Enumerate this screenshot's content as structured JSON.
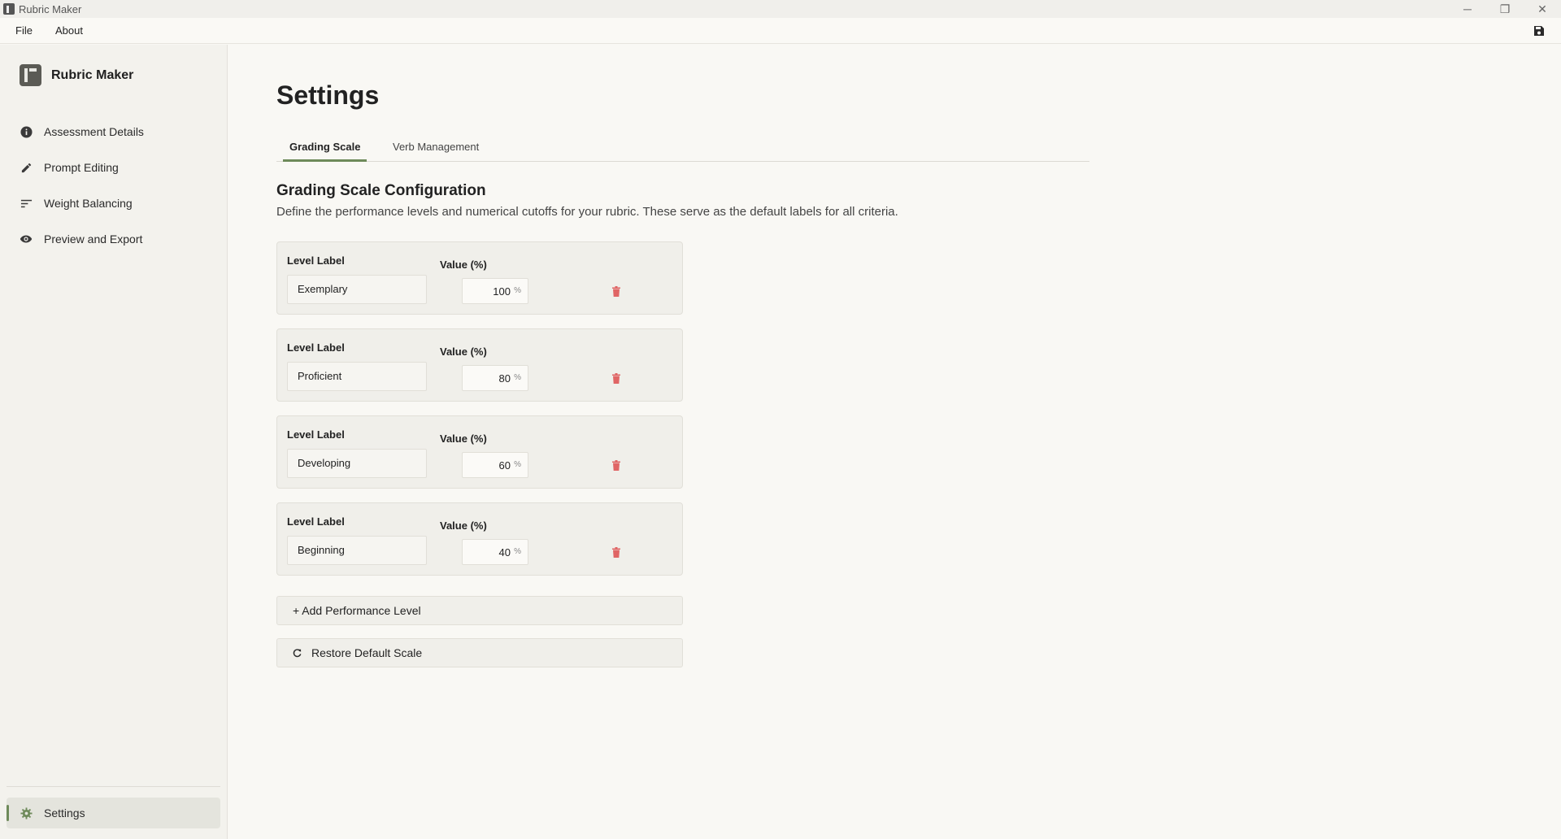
{
  "window": {
    "title": "Rubric Maker",
    "controls": {
      "minimize": "─",
      "maximize": "❐",
      "close": "✕"
    }
  },
  "menu": {
    "file": "File",
    "about": "About"
  },
  "sidebar": {
    "brand": "Rubric Maker",
    "items": [
      {
        "label": "Assessment Details",
        "icon": "info-icon"
      },
      {
        "label": "Prompt Editing",
        "icon": "pencil-icon"
      },
      {
        "label": "Weight Balancing",
        "icon": "sort-lines-icon"
      },
      {
        "label": "Preview and Export",
        "icon": "eye-icon"
      }
    ],
    "settings": {
      "label": "Settings",
      "icon": "gear-icon"
    }
  },
  "main": {
    "title": "Settings",
    "tabs": [
      {
        "label": "Grading Scale",
        "active": true
      },
      {
        "label": "Verb Management",
        "active": false
      }
    ],
    "section_title": "Grading Scale Configuration",
    "section_desc": "Define the performance levels and numerical cutoffs for your rubric. These serve as the default labels for all criteria.",
    "level_label_header": "Level Label",
    "value_header": "Value (%)",
    "percent_symbol": "%",
    "levels": [
      {
        "label": "Exemplary",
        "value": "100"
      },
      {
        "label": "Proficient",
        "value": "80"
      },
      {
        "label": "Developing",
        "value": "60"
      },
      {
        "label": "Beginning",
        "value": "40"
      }
    ],
    "add_button": "+ Add Performance Level",
    "restore_button": "Restore Default Scale"
  },
  "colors": {
    "accent": "#6e8a5a",
    "delete": "#e06565",
    "background": "#f9f8f4",
    "sidebar": "#f3f2ed"
  }
}
